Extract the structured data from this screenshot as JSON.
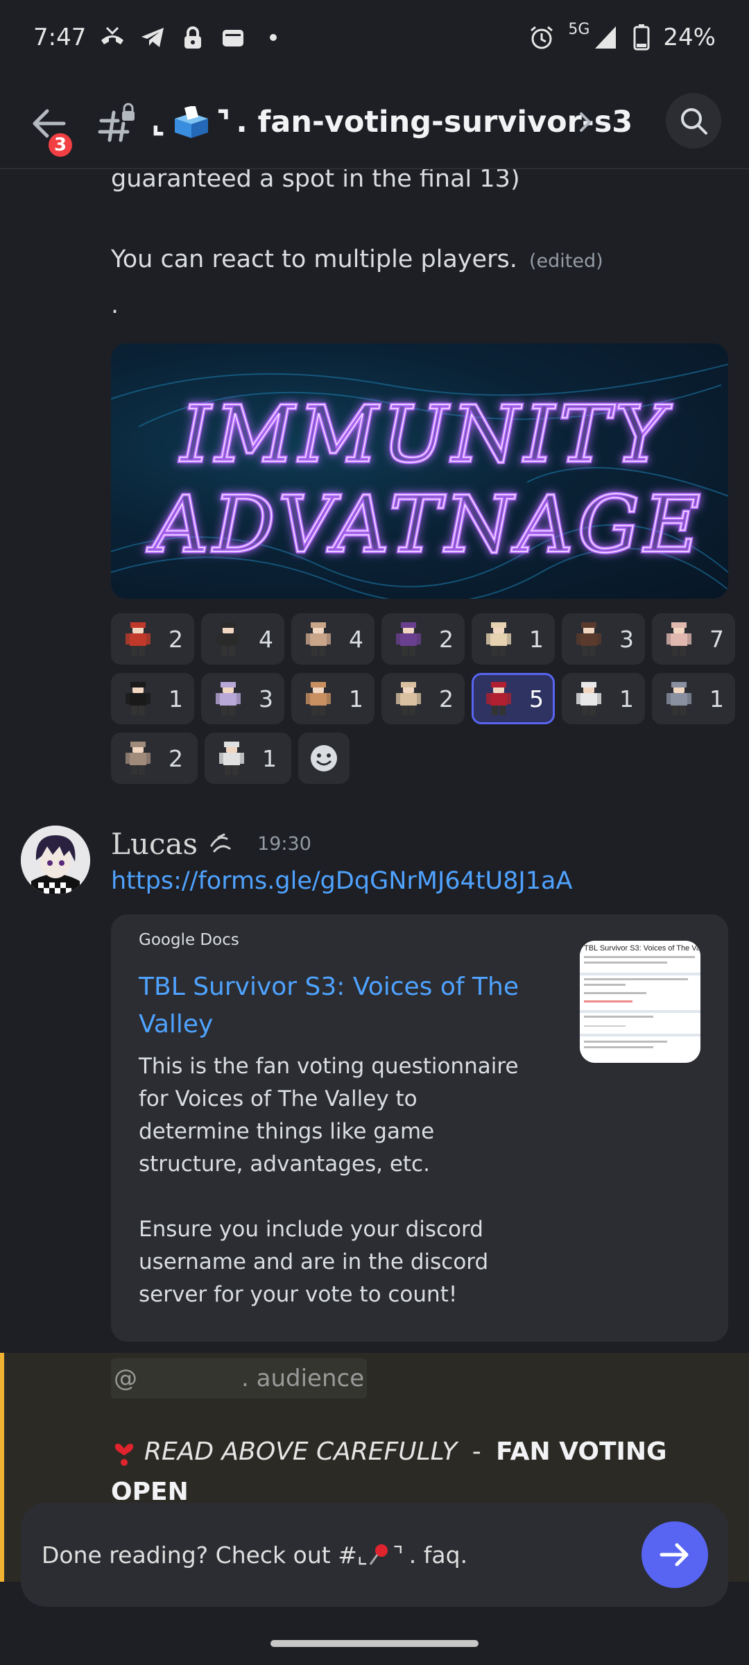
{
  "status_bar": {
    "time": "7:47",
    "network": "5G",
    "battery": "24%",
    "icons_left": [
      "missed-call-icon",
      "telegram-icon",
      "lock-icon",
      "wallet-icon",
      "dot-icon"
    ],
    "icons_right": [
      "alarm-icon",
      "signal-icon",
      "battery-icon"
    ]
  },
  "header": {
    "back_badge": "3",
    "channel_name": ". fan-voting-survivor-s3",
    "channel_prefix_left": "⌞",
    "channel_prefix_right": "⌝"
  },
  "messages": {
    "line1": "guaranteed a spot in the final 13)",
    "line2": "You can react to multiple players.",
    "edited": "(edited)",
    "dot": ".",
    "banner_text_top": "IMMUNITY",
    "banner_text_bottom": "ADVATNAGE"
  },
  "reactions": {
    "row1": [
      {
        "count": "2",
        "color": "#c0392b"
      },
      {
        "count": "4",
        "color": "#2a2a2a"
      },
      {
        "count": "4",
        "color": "#c9a58a"
      },
      {
        "count": "2",
        "color": "#6a3f8f"
      },
      {
        "count": "1",
        "color": "#e6d2b0"
      },
      {
        "count": "3",
        "color": "#5a3a2c"
      },
      {
        "count": "7",
        "color": "#e0b8b0"
      }
    ],
    "row2": [
      {
        "count": "1",
        "color": "#1a1a1a",
        "active": false
      },
      {
        "count": "3",
        "color": "#b8a8d8",
        "active": false
      },
      {
        "count": "1",
        "color": "#c89060",
        "active": false
      },
      {
        "count": "2",
        "color": "#d8c0a0",
        "active": false
      },
      {
        "count": "5",
        "color": "#b02030",
        "active": true
      },
      {
        "count": "1",
        "color": "#e8e8e8",
        "active": false
      },
      {
        "count": "1",
        "color": "#8a90a0",
        "active": false
      }
    ],
    "row3": [
      {
        "count": "2",
        "color": "#a08a7a"
      },
      {
        "count": "1",
        "color": "#e0e0e0"
      }
    ]
  },
  "lucas": {
    "author": "Lucas",
    "timestamp": "19:30",
    "link": "https://forms.gle/gDqGNrMJ64tU8J1aA",
    "embed": {
      "provider": "Google Docs",
      "title": "TBL Survivor S3: Voices of The Valley",
      "description": "This is the fan voting questionnaire for Voices of The Valley to determine things like game structure, advantages, etc.\n\nEnsure you include your discord username and are in the discord server for your vote to count!",
      "thumb_title": "TBL Survivor S3: Voices of The Va"
    }
  },
  "mention": {
    "at": "@",
    "role": ". audience",
    "read_italic": "READ ABOVE CAREFULLY",
    "read_sep": " - ",
    "read_bold": "FAN VOTING",
    "read_bold2": "OPEN"
  },
  "bottom_bar": {
    "text_before": "Done reading? Check out #",
    "text_after": ". faq."
  }
}
